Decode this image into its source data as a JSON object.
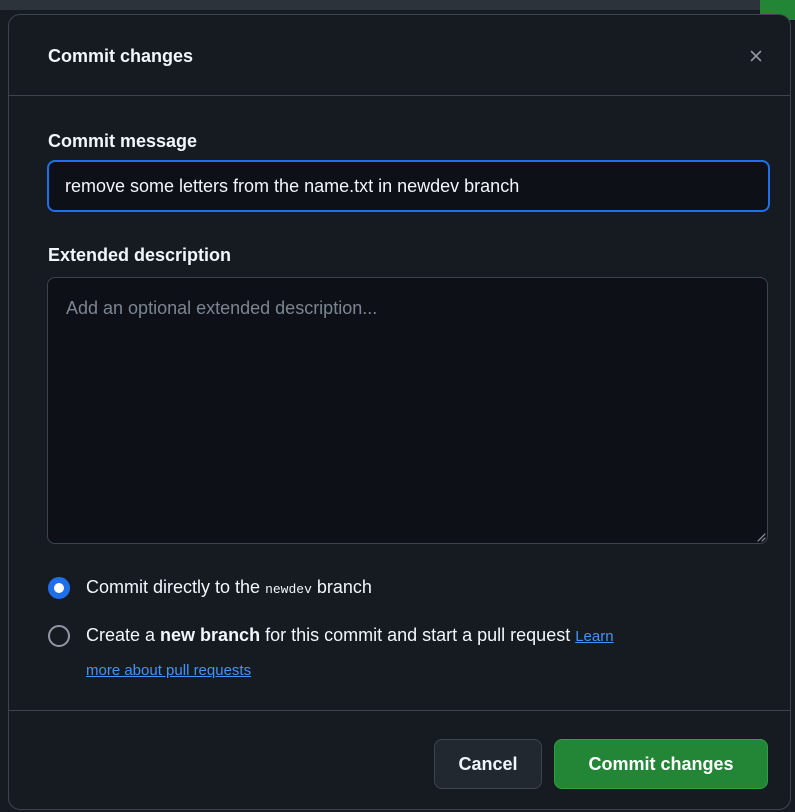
{
  "dialog": {
    "title": "Commit changes",
    "close_icon": "close-icon"
  },
  "commit_message": {
    "label": "Commit message",
    "value": "remove some letters from the name.txt in newdev branch"
  },
  "extended_description": {
    "label": "Extended description",
    "placeholder": "Add an optional extended description..."
  },
  "options": {
    "direct": {
      "prefix": "Commit directly to the ",
      "branch": "newdev",
      "suffix": " branch",
      "checked": true
    },
    "new_branch": {
      "prefix": "Create a ",
      "bold": "new branch",
      "suffix": " for this commit and start a pull request ",
      "link_part1": "Learn",
      "link_part2": "more about pull requests",
      "checked": false
    }
  },
  "footer": {
    "cancel_label": "Cancel",
    "commit_label": "Commit changes"
  },
  "colors": {
    "accent_blue": "#1f6feb",
    "link_blue": "#4493f8",
    "primary_green": "#238636",
    "dialog_bg": "#161b22",
    "input_bg": "#0d1117",
    "border": "#3d444d"
  }
}
